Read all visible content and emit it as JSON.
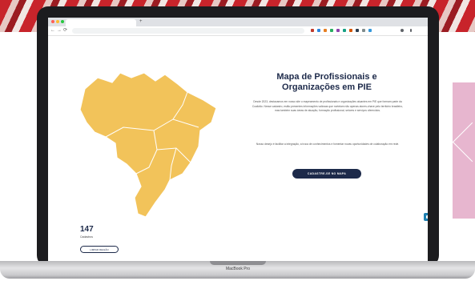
{
  "browser": {
    "tab_title": "",
    "new_tab": "+",
    "url": "",
    "nav": {
      "back": "←",
      "forward": "→",
      "reload": "⟳"
    }
  },
  "map_panel": {
    "filter_label": "",
    "count": "147",
    "count_label": "Cadastros",
    "clear_button": "LIMPAR REGIÃO",
    "search_placeholder": ""
  },
  "content": {
    "title": "Mapa de Profissionais e Organizações em PIE",
    "paragraph_1": "Desde 2023, destacamos em nosso site o mapeamento de profissionais e organizações atuantes em PIE que formam parte da Coalizão. Nesse cadastro, estão presentes informações valiosas que norteiam não apenas atores-chave pelo território brasileiro, mas também suas áreas de atuação, formação profissional, setores e serviços oferecidos.",
    "paragraph_2": "Nosso desejo é facilitar a integração, a troca de conhecimentos e fomentar novas oportunidades de colaboração em rede.",
    "cta_button": "CADASTRE-SE NO MAPA"
  },
  "social": {
    "instagram": "◎",
    "linkedin": "in",
    "youtube": "▶"
  },
  "scroll_top": "⌃",
  "device": {
    "brand": "MacBook Pro"
  },
  "colors": {
    "map_fill": "#f2c35a",
    "navy": "#1d2a4a",
    "banner_red": "#c8242b",
    "pink": "#e7b6cf"
  }
}
